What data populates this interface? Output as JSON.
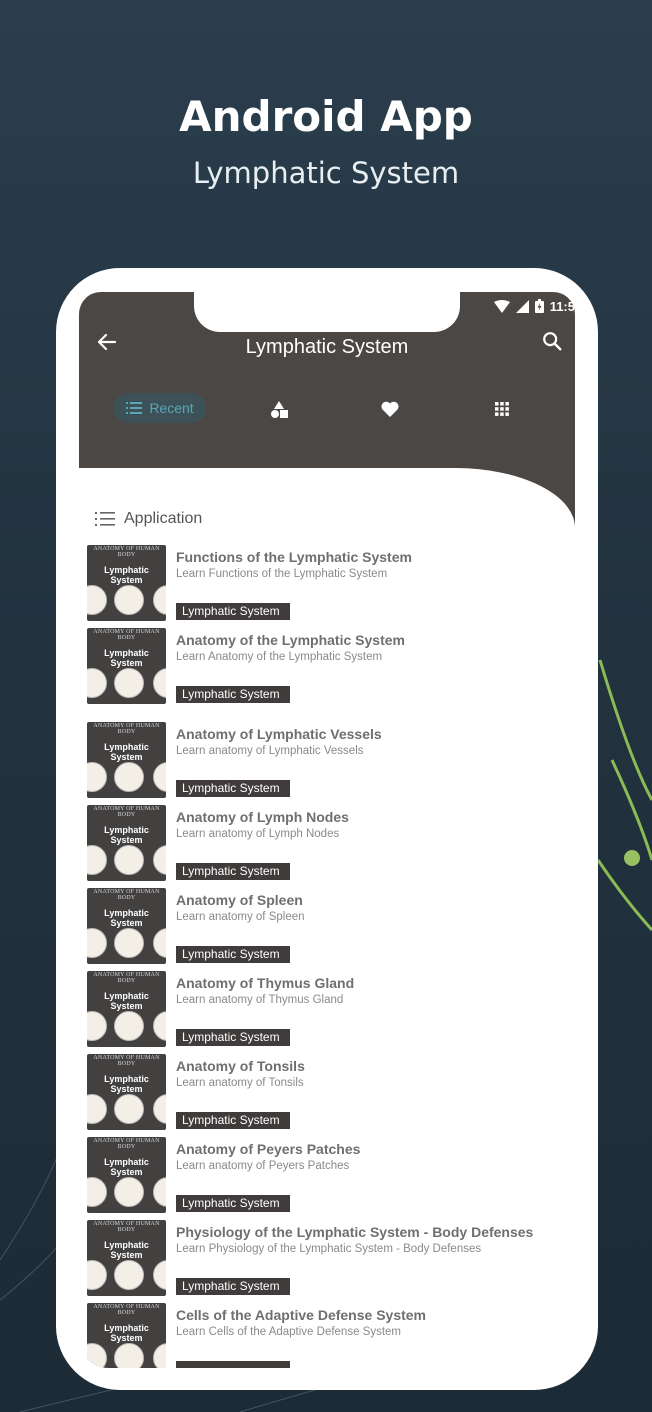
{
  "promo": {
    "title": "Android App",
    "subtitle": "Lymphatic System"
  },
  "status_bar": {
    "time": "11:5",
    "icons": [
      "wifi-icon",
      "signal-icon",
      "battery-icon"
    ]
  },
  "app_bar": {
    "title": "Lymphatic System",
    "back_icon": "arrow-left-icon",
    "search_icon": "search-icon"
  },
  "tabs": [
    {
      "label": "Recent",
      "icon": "list-icon",
      "active": true
    },
    {
      "label": "",
      "icon": "shapes-icon",
      "active": false
    },
    {
      "label": "",
      "icon": "heart-icon",
      "active": false
    },
    {
      "label": "",
      "icon": "grid-icon",
      "active": false
    }
  ],
  "colors": {
    "header": "#4b4745",
    "accent": "#5aa6b8",
    "tag_bg": "#3f3c3b",
    "background": "#22323f"
  },
  "section": {
    "label": "Application",
    "icon": "list-icon"
  },
  "thumbnail": {
    "top_text": "ANATOMY OF HUMAN BODY",
    "title": "Lymphatic System"
  },
  "items": [
    {
      "title": "Functions of the Lymphatic System",
      "subtitle": "Learn Functions of the Lymphatic System",
      "tag": "Lymphatic System"
    },
    {
      "title": "Anatomy of the Lymphatic System",
      "subtitle": "Learn Anatomy of the Lymphatic System",
      "tag": "Lymphatic System"
    },
    {
      "title": "Anatomy of Lymphatic Vessels",
      "subtitle": "Learn anatomy of Lymphatic Vessels",
      "tag": "Lymphatic System"
    },
    {
      "title": "Anatomy of Lymph Nodes",
      "subtitle": "Learn anatomy of Lymph Nodes",
      "tag": "Lymphatic System"
    },
    {
      "title": "Anatomy of Spleen",
      "subtitle": "Learn anatomy of Spleen",
      "tag": "Lymphatic System"
    },
    {
      "title": "Anatomy of Thymus Gland",
      "subtitle": "Learn anatomy of Thymus Gland",
      "tag": "Lymphatic System"
    },
    {
      "title": "Anatomy of Tonsils",
      "subtitle": "Learn anatomy of Tonsils",
      "tag": "Lymphatic System"
    },
    {
      "title": "Anatomy of Peyers Patches",
      "subtitle": "Learn anatomy of Peyers Patches",
      "tag": "Lymphatic System"
    },
    {
      "title": "Physiology of the Lymphatic System - Body Defenses",
      "subtitle": "Learn Physiology of the Lymphatic System - Body Defenses",
      "tag": "Lymphatic System"
    },
    {
      "title": "Cells of the Adaptive Defense System",
      "subtitle": "Learn Cells of the Adaptive Defense System",
      "tag": ""
    }
  ]
}
